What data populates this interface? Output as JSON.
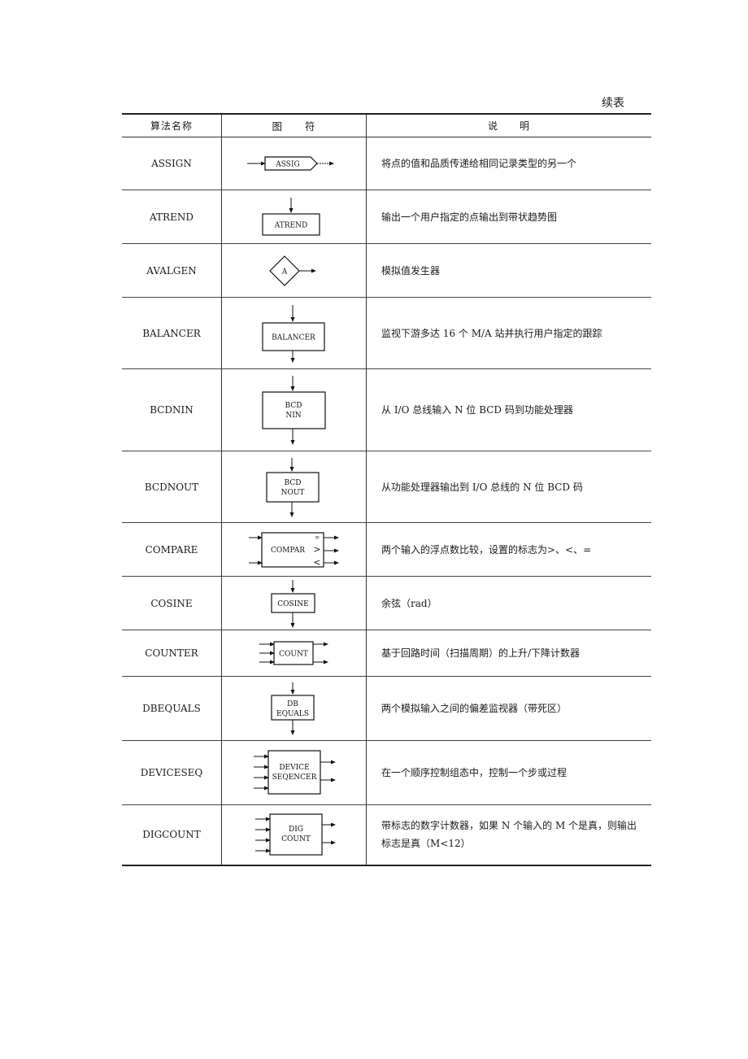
{
  "continued_label": "续表",
  "headers": {
    "name": "算法名称",
    "symbol": "图　　符",
    "description": "说　　明"
  },
  "rows": [
    {
      "name": "ASSIGN",
      "symbol": "ASSIG",
      "description": "将点的值和品质传递给相同记录类型的另一个"
    },
    {
      "name": "ATREND",
      "symbol": "ATREND",
      "description": "输出一个用户指定的点输出到带状趋势图"
    },
    {
      "name": "AVALGEN",
      "symbol": "A",
      "description": "模拟值发生器"
    },
    {
      "name": "BALANCER",
      "symbol": "BALANCER",
      "description": "监视下游多达 16 个 M/A 站并执行用户指定的跟踪"
    },
    {
      "name": "BCDNIN",
      "symbol_lines": [
        "BCD",
        "NIN"
      ],
      "description": "从 I/O 总线输入 N 位 BCD 码到功能处理器"
    },
    {
      "name": "BCDNOUT",
      "symbol_lines": [
        "BCD",
        "NOUT"
      ],
      "description": "从功能处理器输出到 I/O 总线的 N 位 BCD 码"
    },
    {
      "name": "COMPARE",
      "symbol": "COMPAR",
      "symbol_flags": [
        "=",
        ">",
        "<"
      ],
      "description": "两个输入的浮点数比较，设置的标志为>、<、="
    },
    {
      "name": "COSINE",
      "symbol": "COSINE",
      "description": "余弦（rad）"
    },
    {
      "name": "COUNTER",
      "symbol": "COUNT",
      "description": "基于回路时间（扫描周期）的上升/下降计数器"
    },
    {
      "name": "DBEQUALS",
      "symbol_lines": [
        "DB",
        "EQUALS"
      ],
      "description": "两个模拟输入之间的偏差监视器（带死区）"
    },
    {
      "name": "DEVICESEQ",
      "symbol_lines": [
        "DEVICE",
        "SEQENCER"
      ],
      "description": "在一个顺序控制组态中，控制一个步或过程"
    },
    {
      "name": "DIGCOUNT",
      "symbol_lines": [
        "DIG",
        "COUNT"
      ],
      "description": "带标志的数字计数器，如果 N 个输入的 M 个是真，则输出标志是真（M<12）"
    }
  ]
}
